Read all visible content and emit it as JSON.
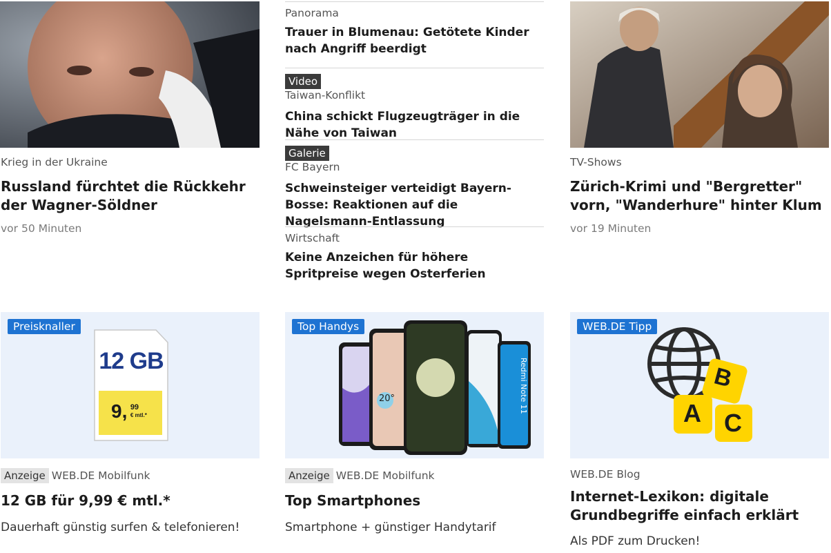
{
  "left_article": {
    "image_alt_icon": "portrait-photo",
    "kicker": "Krieg in der Ukraine",
    "headline": "Russland fürchtet die Rückkehr der Wagner-Söldner",
    "time": "vor 50 Minuten"
  },
  "middle_articles": [
    {
      "kicker": "Panorama",
      "badge": "",
      "headline": "Trauer in Blumenau: Getötete Kinder nach Angriff beerdigt"
    },
    {
      "kicker": "Taiwan-Konflikt",
      "badge": "Video",
      "headline": "China schickt Flugzeugträger in die Nähe von Taiwan"
    },
    {
      "kicker": "FC Bayern",
      "badge": "Galerie",
      "headline": "Schweinsteiger verteidigt Bayern-Bosse: Reaktionen auf die Nagelsmann-Entlassung"
    },
    {
      "kicker": "Wirtschaft",
      "badge": "",
      "headline": "Keine Anzeichen für höhere Spritpreise wegen Osterferien"
    }
  ],
  "right_article": {
    "image_alt_icon": "tv-scene-photo",
    "kicker": "TV-Shows",
    "headline": "Zürich-Krimi und \"Bergretter\" vorn, \"Wanderhure\" hinter Klum",
    "time": "vor 19 Minuten"
  },
  "promo_tiles": [
    {
      "badge": "Preisknaller",
      "sim_gb": "12 GB",
      "price_main": "9,",
      "price_cents": "99",
      "price_unit": "€ mtl.*",
      "ad_label": "Anzeige",
      "source": "WEB.DE Mobilfunk",
      "headline": "12 GB für 9,99 € mtl.*",
      "subline": "Dauerhaft günstig surfen & telefonieren!"
    },
    {
      "badge": "Top Handys",
      "phone_time": "20°",
      "phone_label": "Redmi Note 11",
      "ad_label": "Anzeige",
      "source": "WEB.DE Mobilfunk",
      "headline": "Top Smartphones",
      "subline": "Smartphone + günstiger Handytarif"
    },
    {
      "badge": "WEB.DE Tipp",
      "block_letters": [
        "B",
        "A",
        "C"
      ],
      "source": "WEB.DE Blog",
      "headline": "Internet-Lexikon: digitale Grundbegriffe einfach erklärt",
      "subline": "Als PDF zum Drucken!"
    }
  ],
  "colors": {
    "accent_blue": "#1e73d2",
    "tile_bg": "#eaf1fb",
    "sim_price_yellow": "#f6e24a",
    "block_yellow": "#ffd400"
  }
}
